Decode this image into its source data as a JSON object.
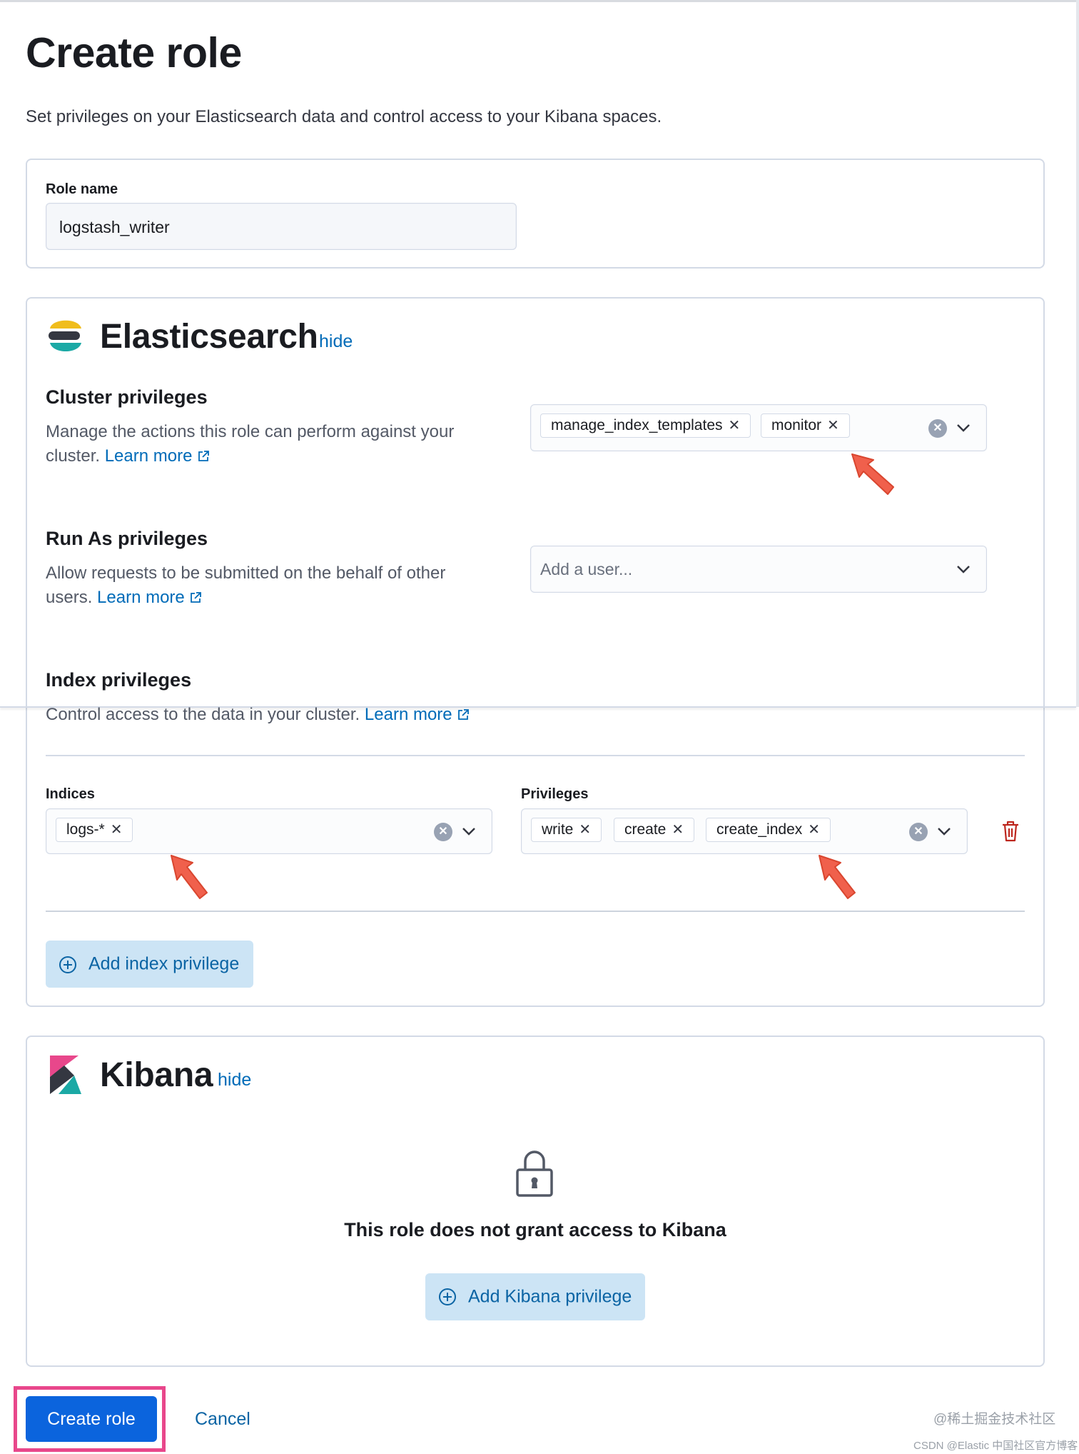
{
  "page": {
    "title": "Create role",
    "description": "Set privileges on your Elasticsearch data and control access to your Kibana spaces."
  },
  "role_name": {
    "label": "Role name",
    "value": "logstash_writer"
  },
  "elasticsearch": {
    "title": "Elasticsearch",
    "hide_label": "hide",
    "cluster": {
      "title": "Cluster privileges",
      "help": "Manage the actions this role can perform against your cluster.",
      "learn_more": "Learn more",
      "selected": [
        "manage_index_templates",
        "monitor"
      ]
    },
    "run_as": {
      "title": "Run As privileges",
      "help": "Allow requests to be submitted on the behalf of other users.",
      "learn_more": "Learn more",
      "placeholder": "Add a user..."
    },
    "index": {
      "title": "Index privileges",
      "help": "Control access to the data in your cluster.",
      "learn_more": "Learn more",
      "indices_label": "Indices",
      "indices": [
        "logs-*"
      ],
      "privileges_label": "Privileges",
      "privileges": [
        "write",
        "create",
        "create_index"
      ],
      "add_button": "Add index privilege"
    }
  },
  "kibana": {
    "title": "Kibana",
    "hide_label": "hide",
    "empty_message": "This role does not grant access to Kibana",
    "add_button": "Add Kibana privilege"
  },
  "footer": {
    "create_button": "Create role",
    "cancel_button": "Cancel"
  },
  "watermark": {
    "line1": "@稀土掘金技术社区",
    "line2": "CSDN @Elastic 中国社区官方博客"
  },
  "icons": {
    "external_link": "external-link-icon",
    "clear": "clear-icon",
    "chevron": "chevron-down-icon",
    "trash": "trash-icon",
    "plus_circle": "plus-circle-icon",
    "lock": "lock-icon",
    "annotation_arrow": "annotation-arrow-icon"
  },
  "colors": {
    "link": "#006bb8",
    "primary": "#0b64dd",
    "annotation_arrow": "#f0604c",
    "focus_highlight": "#e8478b",
    "danger": "#bd271e"
  }
}
